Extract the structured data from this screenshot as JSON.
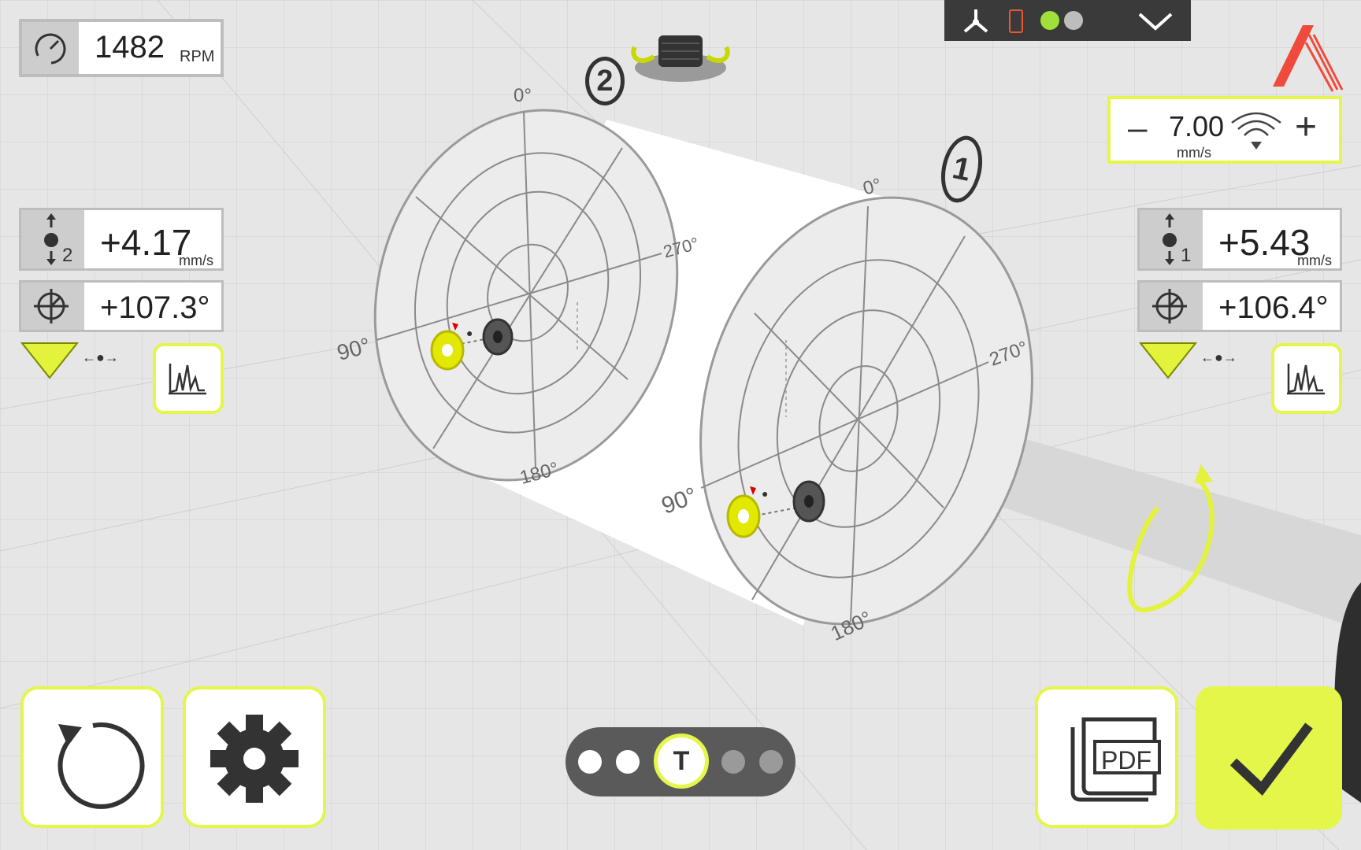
{
  "rpm": {
    "value": "1482",
    "unit": "RPM",
    "icon": "gauge-icon"
  },
  "plane2": {
    "label": "2",
    "amplitude": "+4.17",
    "amplitude_unit": "mm/s",
    "sensor_label": "2",
    "phase": "+107.3°"
  },
  "plane1": {
    "label": "1",
    "amplitude": "+5.43",
    "amplitude_unit": "mm/s",
    "sensor_label": "1",
    "phase": "+106.4°"
  },
  "tolerance": {
    "minus": "–",
    "value": "7.00",
    "unit": "mm/s",
    "plus": "+"
  },
  "angles": {
    "a0": "0°",
    "a90": "90°",
    "a180": "180°",
    "a270": "270°"
  },
  "pager": {
    "current_label": "T"
  },
  "pdf_label": "PDF",
  "colors": {
    "accent": "#e4f64a",
    "brand": "#ef4a3c",
    "statusbar": "#3a3a3a"
  }
}
